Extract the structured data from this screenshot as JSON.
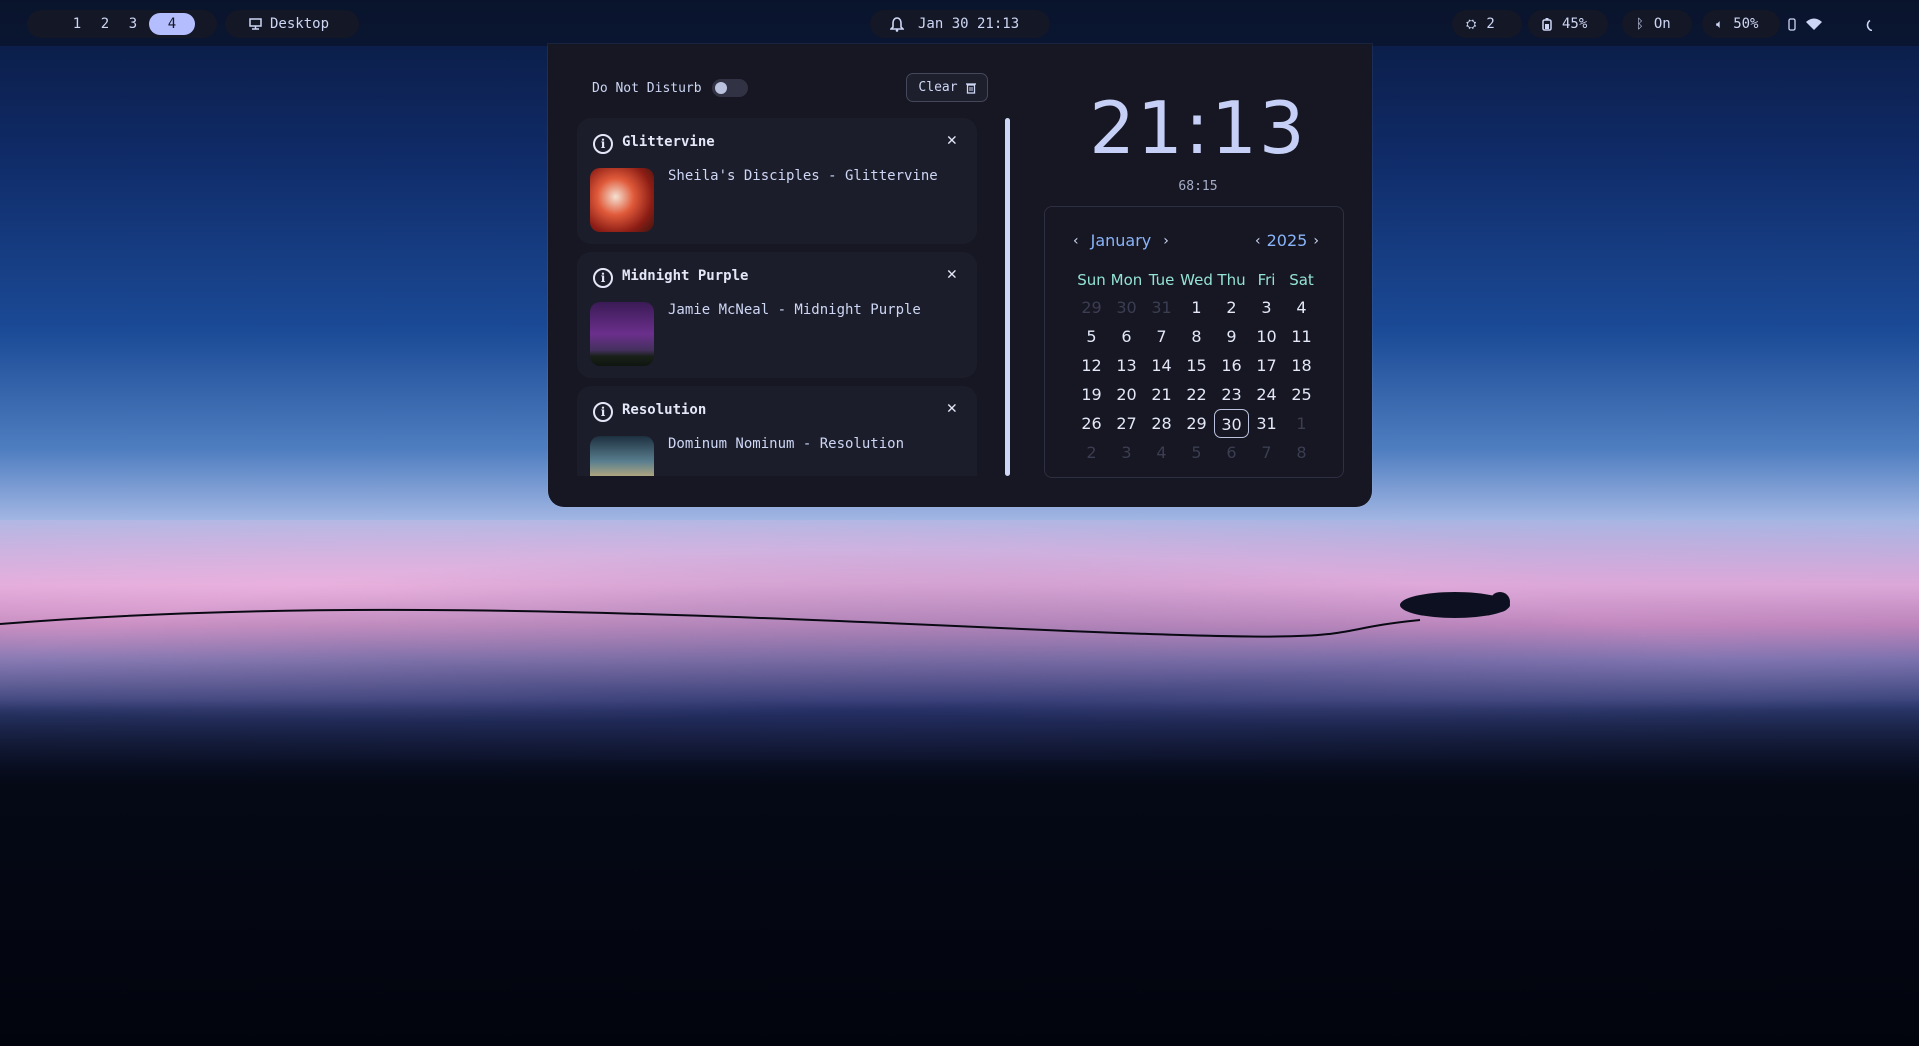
{
  "topbar": {
    "workspaces": [
      "1",
      "2",
      "3",
      "4"
    ],
    "active_workspace": "4",
    "desktop_label": "Desktop",
    "datetime": "Jan 30 21:13",
    "updates": "2",
    "battery": "45%",
    "bluetooth": "On",
    "volume": "50%"
  },
  "panel": {
    "dnd_label": "Do Not Disturb",
    "dnd_enabled": false,
    "clear_label": "Clear",
    "notifications": [
      {
        "title": "Glittervine",
        "body": "Sheila's Disciples - Glittervine",
        "thumb_color": "#c0392b"
      },
      {
        "title": "Midnight Purple",
        "body": "Jamie McNeal - Midnight Purple",
        "thumb_color": "#5b2a7a"
      },
      {
        "title": "Resolution",
        "body": "Dominum Nominum - Resolution",
        "thumb_color": "#2a3f52"
      }
    ],
    "clock": "21:13",
    "uptime": "68:15",
    "calendar": {
      "month": "January",
      "year": "2025",
      "day_names": [
        "Sun",
        "Mon",
        "Tue",
        "Wed",
        "Thu",
        "Fri",
        "Sat"
      ],
      "weeks": [
        [
          {
            "d": "29",
            "dim": true
          },
          {
            "d": "30",
            "dim": true
          },
          {
            "d": "31",
            "dim": true
          },
          {
            "d": "1"
          },
          {
            "d": "2"
          },
          {
            "d": "3"
          },
          {
            "d": "4"
          }
        ],
        [
          {
            "d": "5"
          },
          {
            "d": "6"
          },
          {
            "d": "7"
          },
          {
            "d": "8"
          },
          {
            "d": "9"
          },
          {
            "d": "10"
          },
          {
            "d": "11"
          }
        ],
        [
          {
            "d": "12"
          },
          {
            "d": "13"
          },
          {
            "d": "14"
          },
          {
            "d": "15"
          },
          {
            "d": "16"
          },
          {
            "d": "17"
          },
          {
            "d": "18"
          }
        ],
        [
          {
            "d": "19"
          },
          {
            "d": "20"
          },
          {
            "d": "21"
          },
          {
            "d": "22"
          },
          {
            "d": "23"
          },
          {
            "d": "24"
          },
          {
            "d": "25"
          }
        ],
        [
          {
            "d": "26"
          },
          {
            "d": "27"
          },
          {
            "d": "28"
          },
          {
            "d": "29"
          },
          {
            "d": "30",
            "today": true
          },
          {
            "d": "31"
          },
          {
            "d": "1",
            "dim": true
          }
        ],
        [
          {
            "d": "2",
            "dim": true
          },
          {
            "d": "3",
            "dim": true
          },
          {
            "d": "4",
            "dim": true
          },
          {
            "d": "5",
            "dim": true
          },
          {
            "d": "6",
            "dim": true
          },
          {
            "d": "7",
            "dim": true
          },
          {
            "d": "8",
            "dim": true
          }
        ]
      ]
    }
  },
  "colors": {
    "accent": "#b4befe",
    "calendar_header": "#89b4fa",
    "day_names": "#94e2d5"
  }
}
